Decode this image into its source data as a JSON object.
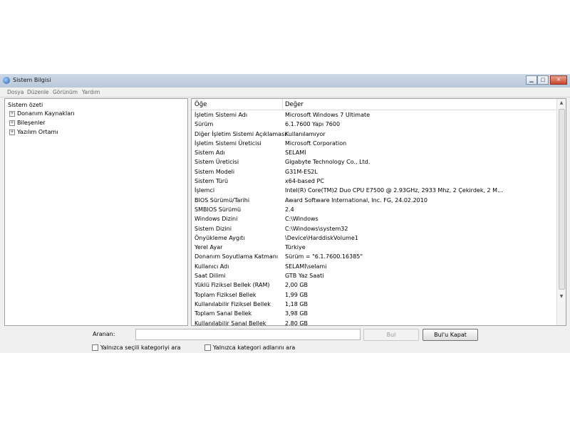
{
  "window": {
    "title": "Sistem Bilgisi"
  },
  "titlebar_buttons": {
    "minimize": "▁",
    "maximize": "□",
    "close": "✕"
  },
  "menu": [
    "Dosya",
    "Düzenle",
    "Görünüm",
    "Yardım"
  ],
  "tree": {
    "root": "Sistem özeti",
    "children": [
      "Donanım Kaynakları",
      "Bileşenler",
      "Yazılım Ortamı"
    ],
    "expander": "+"
  },
  "table": {
    "columns": [
      "Öğe",
      "Değer"
    ],
    "rows": [
      [
        "İşletim Sistemi Adı",
        "Microsoft Windows 7 Ultimate"
      ],
      [
        "Sürüm",
        "6.1.7600 Yapı 7600"
      ],
      [
        "Diğer İşletim Sistemi Açıklaması",
        "Kullanılamıyor"
      ],
      [
        "İşletim Sistemi Üreticisi",
        "Microsoft Corporation"
      ],
      [
        "Sistem Adı",
        "SELAMİ"
      ],
      [
        "Sistem Üreticisi",
        "Gigabyte Technology Co., Ltd."
      ],
      [
        "Sistem Modeli",
        "G31M-ES2L"
      ],
      [
        "Sistem Türü",
        "x64-based PC"
      ],
      [
        "İşlemci",
        "Intel(R) Core(TM)2 Duo CPU     E7500  @ 2.93GHz, 2933 Mhz, 2 Çekirdek, 2 M..."
      ],
      [
        "BIOS Sürümü/Tarihi",
        "Award Software International, Inc. FG, 24.02.2010"
      ],
      [
        "SMBIOS Sürümü",
        "2.4"
      ],
      [
        "Windows Dizini",
        "C:\\Windows"
      ],
      [
        "Sistem Dizini",
        "C:\\Windows\\system32"
      ],
      [
        "Önyükleme Aygıtı",
        "\\Device\\HarddiskVolume1"
      ],
      [
        "Yerel Ayar",
        "Türkiye"
      ],
      [
        "Donanım Soyutlama Katmanı",
        "Sürüm = \"6.1.7600.16385\""
      ],
      [
        "Kullanıcı Adı",
        "SELAMİ\\selami"
      ],
      [
        "Saat Dilimi",
        "GTB Yaz Saati"
      ],
      [
        "Yüklü Fiziksel Bellek (RAM)",
        "2,00 GB"
      ],
      [
        "Toplam Fiziksel Bellek",
        "1,99 GB"
      ],
      [
        "Kullanılabilir Fiziksel Bellek",
        "1,18 GB"
      ],
      [
        "Toplam Sanal Bellek",
        "3,98 GB"
      ],
      [
        "Kullanılabilir Sanal Bellek",
        "2,80 GB"
      ]
    ]
  },
  "scroll": {
    "up": "▲",
    "down": "▼"
  },
  "search": {
    "label": "Aranan:",
    "value": "",
    "find_button": "Bul",
    "close_find_button": "Bul'u Kapat",
    "option_selected_category": "Yalnızca seçili kategoriyi ara",
    "option_category_names": "Yalnızca kategori adlarını ara"
  }
}
